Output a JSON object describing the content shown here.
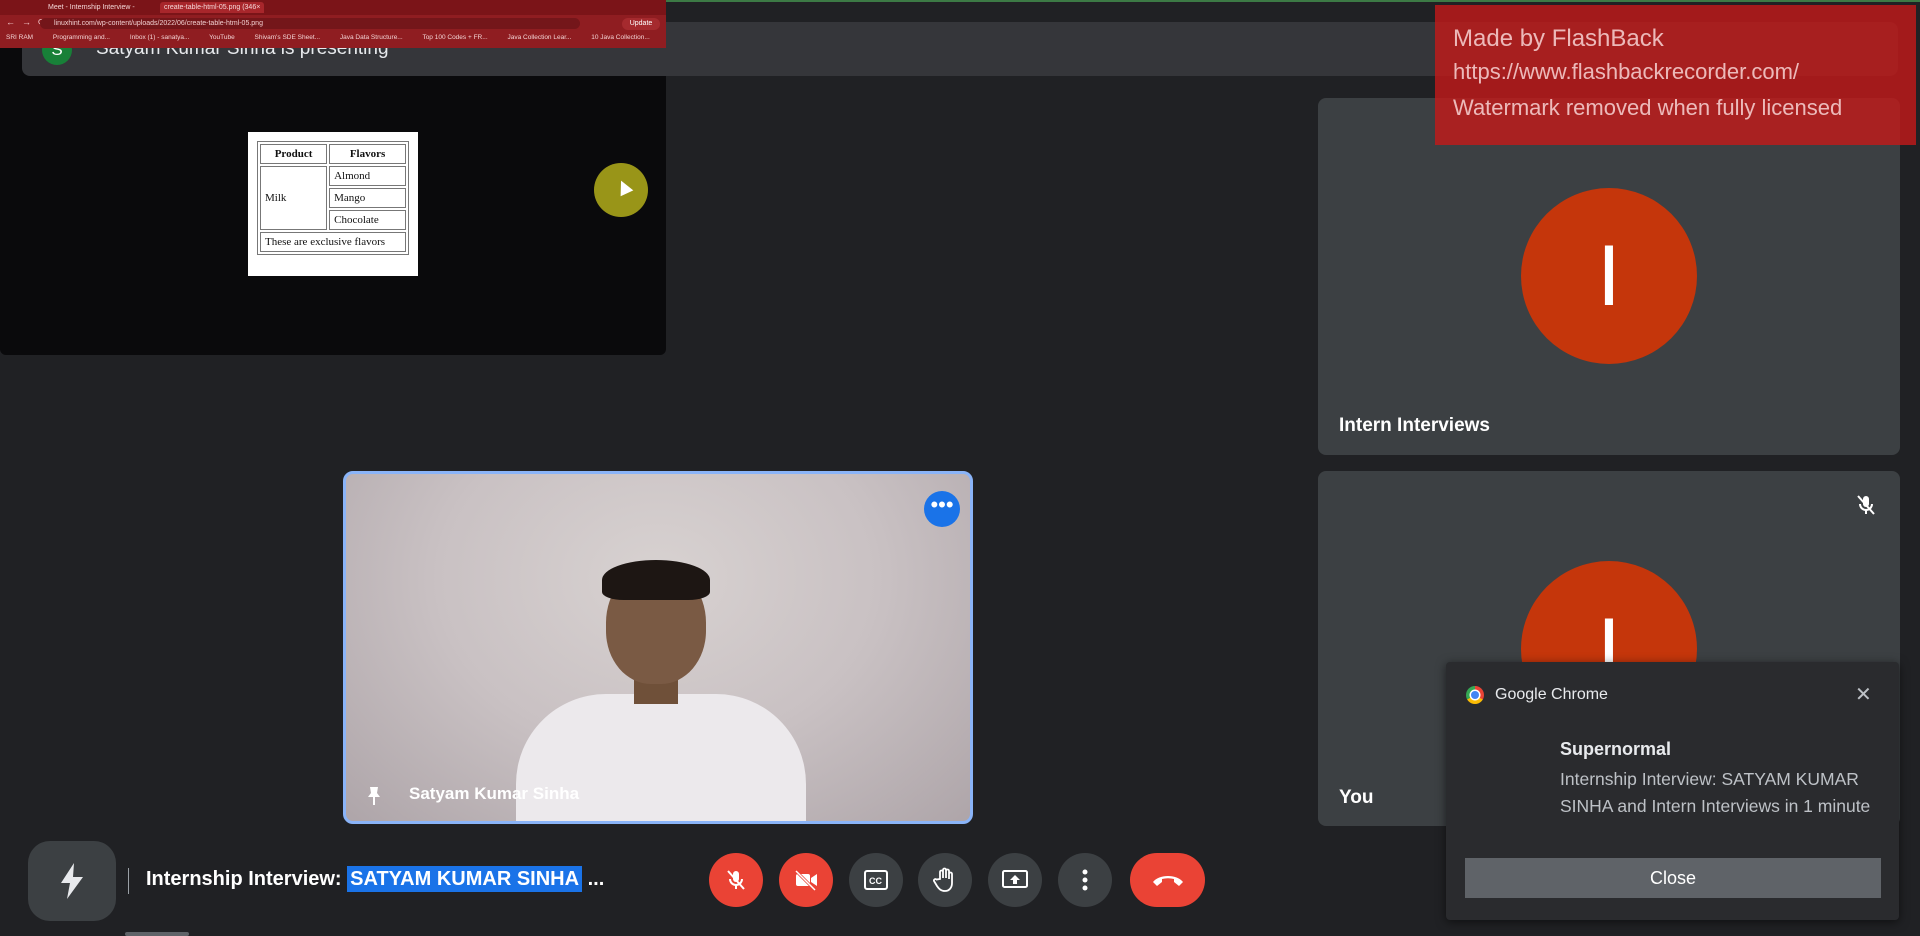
{
  "banner": {
    "avatar_letter": "S",
    "text": "Satyam Kumar Sinha is presenting"
  },
  "watermark": {
    "line1": "Made by FlashBack",
    "line2": "https://www.flashbackrecorder.com/",
    "line3": "Watermark removed when fully licensed"
  },
  "presentation": {
    "tabs": [
      "Meet - Internship Interview -",
      "create-table-html-05.png (346×"
    ],
    "url": "linuxhint.com/wp-content/uploads/2022/06/create-table-html-05.png",
    "update_label": "Update",
    "bookmarks": [
      "SRI RAM",
      "Programming and...",
      "Inbox (1) - sanatya...",
      "YouTube",
      "Shivam's SDE Sheet...",
      "Java Data Structure...",
      "Top 100 Codes + FR...",
      "Java Collection Lear...",
      "10 Java Collection..."
    ],
    "table": {
      "headers": [
        "Product",
        "Flavors"
      ],
      "product": "Milk",
      "flavors": [
        "Almond",
        "Mango",
        "Chocolate"
      ],
      "footer": "These are exclusive flavors"
    }
  },
  "tiles": {
    "camera": {
      "name": "Satyam Kumar Sinha"
    },
    "intern": {
      "initial": "I",
      "name": "Intern Interviews"
    },
    "you": {
      "initial": "I",
      "name": "You"
    }
  },
  "notification": {
    "app": "Google Chrome",
    "title": "Supernormal",
    "body": "Internship Interview: SATYAM KUMAR SINHA and Intern Interviews in 1 minute",
    "close_label": "Close",
    "close_x": "✕"
  },
  "bottom": {
    "meeting_prefix": "Internship Interview: ",
    "meeting_highlight": "SATYAM KUMAR SINHA",
    "meeting_suffix": " ..."
  },
  "colors": {
    "background": "#202124",
    "tile": "#3c4043",
    "avatar": "#c5360b",
    "accent_blue": "#1a73e8",
    "danger_red": "#ea4335",
    "watermark_red": "#c81818"
  }
}
